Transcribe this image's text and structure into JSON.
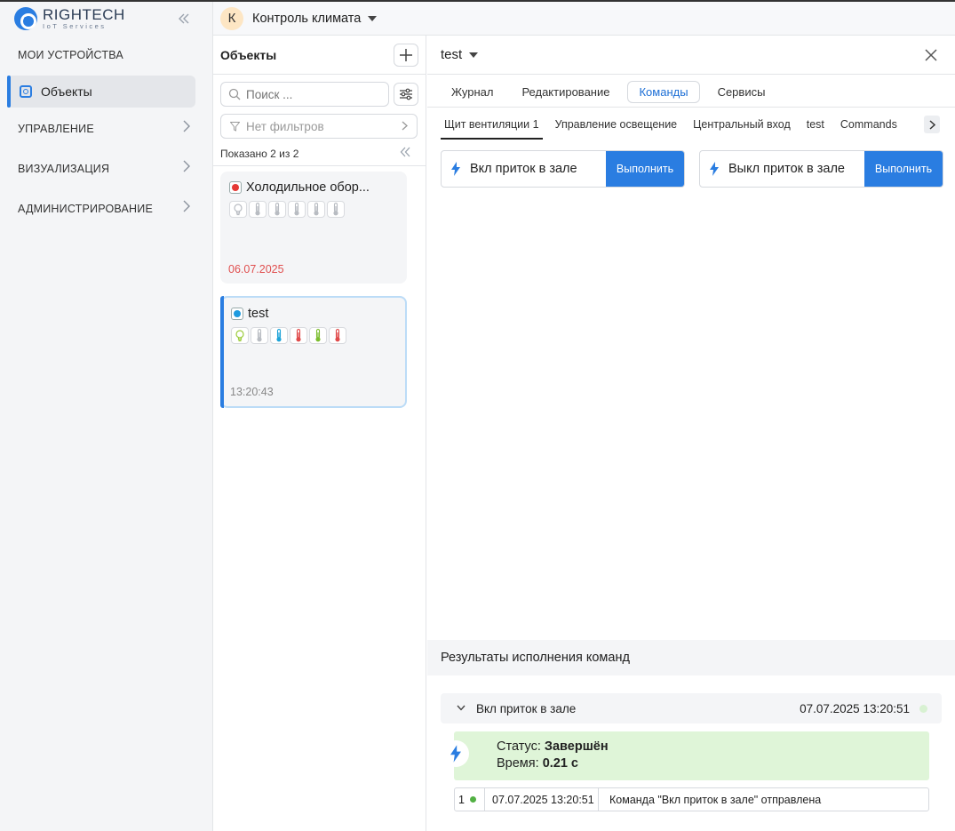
{
  "app": {
    "brand": "RIGHTECH",
    "brand_sub": "IoT Services"
  },
  "sidebar": {
    "sections": [
      {
        "label": "МОИ УСТРОЙСТВА"
      },
      {
        "label": "Объекты",
        "active": true
      },
      {
        "label": "УПРАВЛЕНИЕ"
      },
      {
        "label": "ВИЗУАЛИЗАЦИЯ"
      },
      {
        "label": "АДМИНИСТРИРОВАНИЕ"
      }
    ]
  },
  "topbar": {
    "avatar_letter": "К",
    "project_title": "Контроль климата"
  },
  "objects_panel": {
    "title": "Объекты",
    "search_placeholder": "Поиск ...",
    "filters_label": "Нет фильтров",
    "shown_label": "Показано 2 из 2",
    "cards": [
      {
        "name": "Холодильное обор...",
        "status_color": "#e53935",
        "date": "06.07.2025",
        "date_color": "#e05050",
        "icons": [
          "bulb-icon",
          "thermometer-icon",
          "thermometer-icon",
          "thermometer-icon",
          "thermometer-icon",
          "thermometer-icon"
        ],
        "icon_colors": [
          "#b8bcc2",
          "#b8bcc2",
          "#b8bcc2",
          "#b8bcc2",
          "#b8bcc2",
          "#b8bcc2"
        ]
      },
      {
        "name": "test",
        "status_color": "#1e9be0",
        "date": "13:20:43",
        "date_color": "#888888",
        "selected": true,
        "icons": [
          "bulb-icon",
          "thermometer-icon",
          "thermometer-icon",
          "thermometer-icon",
          "thermometer-icon",
          "thermometer-icon"
        ],
        "icon_colors": [
          "#9ccc3c",
          "#b8bcc2",
          "#1ea3d8",
          "#e04a4a",
          "#7cbd2f",
          "#e04a4a"
        ]
      }
    ]
  },
  "main": {
    "title": "test",
    "tabs": [
      {
        "label": "Журнал"
      },
      {
        "label": "Редактирование"
      },
      {
        "label": "Команды",
        "active": true
      },
      {
        "label": "Сервисы"
      }
    ],
    "subtabs": [
      {
        "label": "Щит вентиляции 1",
        "active": true
      },
      {
        "label": "Управление освещение"
      },
      {
        "label": "Центральный вход"
      },
      {
        "label": "test"
      },
      {
        "label": "Commands"
      }
    ],
    "commands": [
      {
        "label": "Вкл приток в зале",
        "button": "Выполнить"
      },
      {
        "label": "Выкл приток в зале",
        "button": "Выполнить"
      }
    ],
    "results": {
      "title": "Результаты исполнения команд",
      "item": {
        "name": "Вкл приток в зале",
        "timestamp": "07.07.2025 13:20:51",
        "status_prefix": "Статус:",
        "status_value": "Завершён",
        "time_prefix": "Время:",
        "time_value": "0.21 с"
      },
      "log": [
        {
          "num": "1",
          "time": "07.07.2025 13:20:51",
          "message": "Команда \"Вкл приток в зале\" отправлена"
        }
      ]
    }
  },
  "colors": {
    "accent": "#2a7de1",
    "success_bg": "#dff5d8"
  }
}
